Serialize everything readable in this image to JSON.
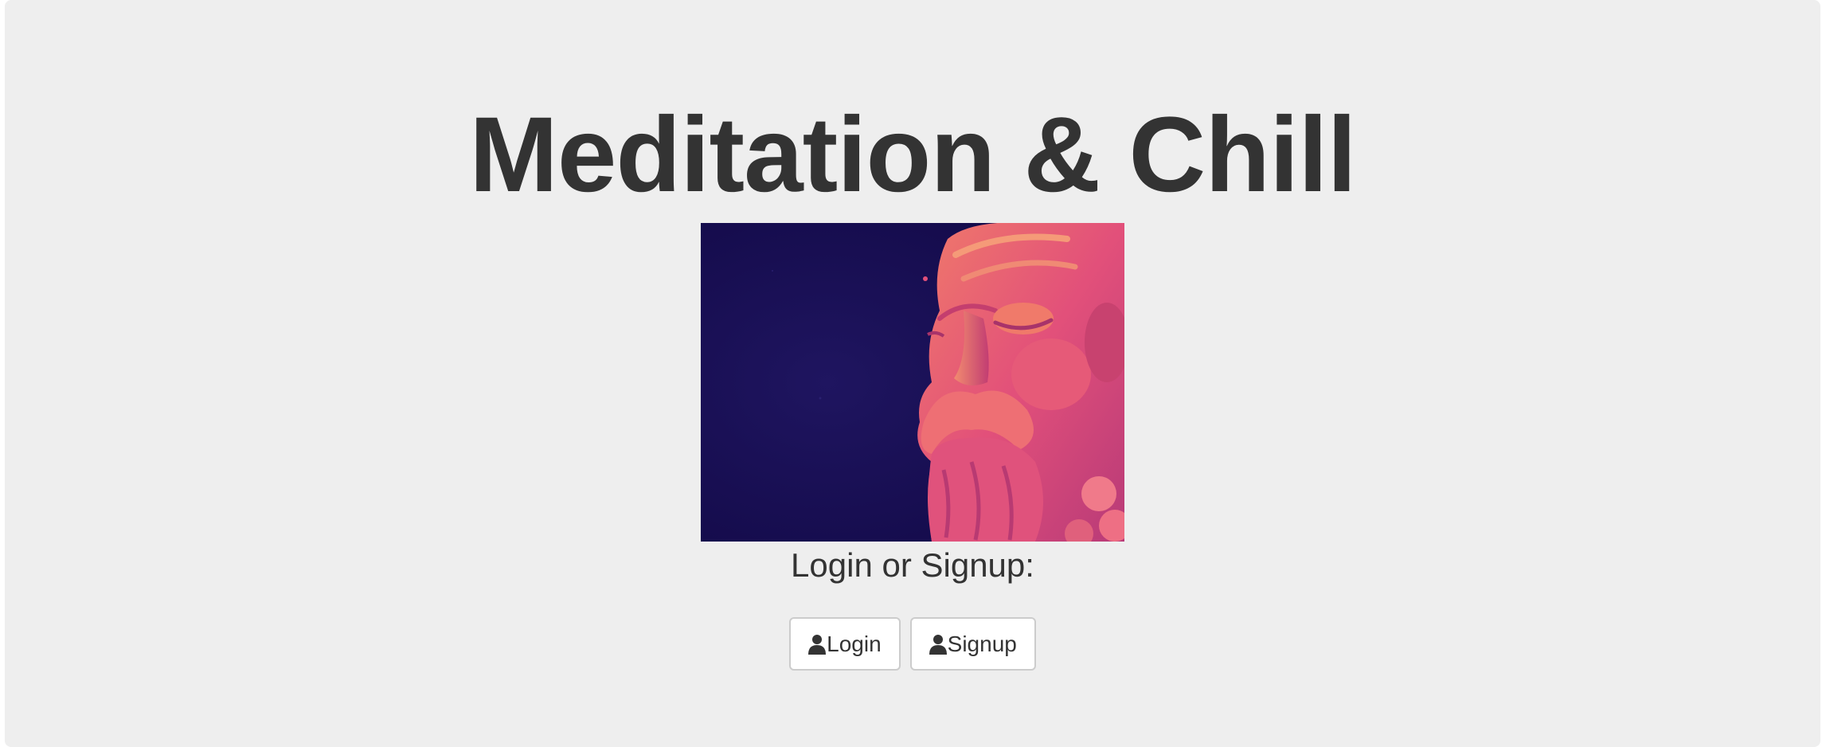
{
  "page": {
    "title": "Meditation & Chill",
    "hero_image": "meditating-bearded-statue-head-image",
    "prompt": "Login or Signup:"
  },
  "buttons": {
    "login": {
      "label": "Login",
      "icon": "user-icon"
    },
    "signup": {
      "label": "Signup",
      "icon": "user-icon"
    }
  },
  "colors": {
    "background": "#eeeeee",
    "text": "#333333",
    "hero_bg": "#150a4d",
    "statue": "#e2507a"
  }
}
